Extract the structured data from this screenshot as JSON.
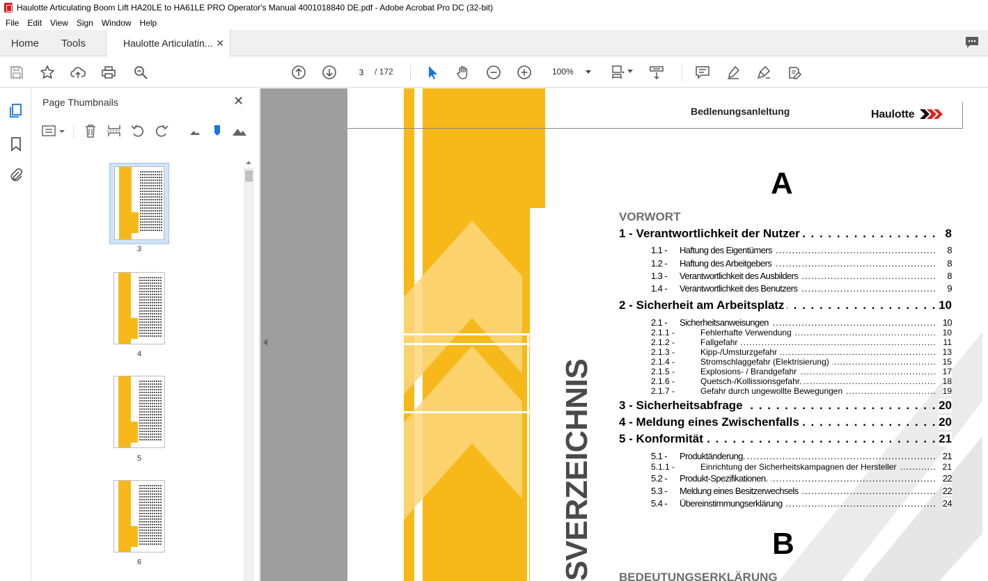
{
  "window": {
    "title": "Haulotte Articulating Boom Lift HA20LE to HA61LE PRO Operator's Manual 4001018840 DE.pdf - Adobe Acrobat Pro DC (32-bit)"
  },
  "menu": [
    "File",
    "Edit",
    "View",
    "Sign",
    "Window",
    "Help"
  ],
  "tabs": {
    "home": "Home",
    "tools": "Tools",
    "document": "Haulotte Articulatin..."
  },
  "toolbar": {
    "page_current": "3",
    "page_total": "/ 172",
    "zoom": "100%"
  },
  "thumbnails": {
    "title": "Page Thumbnails",
    "pages": [
      "3",
      "4",
      "5",
      "6"
    ]
  },
  "document": {
    "header_title": "Bedlenungsanleltung",
    "logo_text": "Haulotte",
    "letter_a": "A",
    "letter_b": "B",
    "section_vorwort": "VORWORT",
    "section_bedeutung": "BEDEUTUNGSERKLÄRUNG",
    "vertical_title": "SVERZEICHNIS",
    "toc": [
      {
        "level": 1,
        "num": "",
        "text": "1 - Verantwortlichkeit der Nutzer",
        "page": "8"
      },
      {
        "level": 2,
        "num": "1.1 -",
        "text": "Haftung des Eigentümers",
        "page": "8"
      },
      {
        "level": 2,
        "num": "1.2 -",
        "text": "Haftung des Arbeitgebers",
        "page": "8"
      },
      {
        "level": 2,
        "num": "1.3 -",
        "text": "Verantwortlichkeit des Ausbilders",
        "page": "8"
      },
      {
        "level": 2,
        "num": "1.4 -",
        "text": "Verantwortlichkeit des Benutzers",
        "page": "9"
      },
      {
        "level": 1,
        "num": "",
        "text": "2 - Sicherheit am Arbeitsplatz",
        "page": "10"
      },
      {
        "level": 2,
        "num": "2.1 -",
        "text": "Sicherheitsanweisungen",
        "page": "10"
      },
      {
        "level": 3,
        "num": "2.1.1 -",
        "text": "Fehlerhafte Verwendung",
        "page": "10"
      },
      {
        "level": 3,
        "num": "2.1.2 -",
        "text": "Fallgefahr",
        "page": "11"
      },
      {
        "level": 3,
        "num": "2.1.3 -",
        "text": "Kipp-/Umsturzgefahr",
        "page": "13"
      },
      {
        "level": 3,
        "num": "2.1.4 -",
        "text": "Stromschlaggefahr (Elektrisierung)",
        "page": "15"
      },
      {
        "level": 3,
        "num": "2.1.5 -",
        "text": "Explosions- / Brandgefahr",
        "page": "17"
      },
      {
        "level": 3,
        "num": "2.1.6 -",
        "text": "Quetsch-/Kollissionsgefahr.",
        "page": "18"
      },
      {
        "level": 3,
        "num": "2.1.7 -",
        "text": "Gefahr durch ungewollte Bewegungen",
        "page": "19"
      },
      {
        "level": 1,
        "num": "",
        "text": "3 - Sicherheitsabfrage",
        "page": "20"
      },
      {
        "level": 1,
        "num": "",
        "text": "4 - Meldung eines Zwischenfalls",
        "page": "20"
      },
      {
        "level": 1,
        "num": "",
        "text": "5 - Konformität",
        "page": "21"
      },
      {
        "level": 2,
        "num": "5.1 -",
        "text": "Produktänderung.",
        "page": "21"
      },
      {
        "level": 3,
        "num": "5.1.1 -",
        "text": "Einrichtung der Sicherheitskampagnen der Hersteller",
        "page": "21"
      },
      {
        "level": 2,
        "num": "5.2 -",
        "text": "Produkt-Spezifikationen.",
        "page": "22"
      },
      {
        "level": 2,
        "num": "5.3 -",
        "text": "Meldung eines Besitzerwechsels",
        "page": "22"
      },
      {
        "level": 2,
        "num": "5.4 -",
        "text": "Übereinstimmungserklärung",
        "page": "24"
      }
    ]
  },
  "colors": {
    "accent_yellow": "#f6b919",
    "doc_background": "#9e9e9e",
    "selection": "#d0e4f7",
    "pdf_red": "#e11a1a"
  }
}
